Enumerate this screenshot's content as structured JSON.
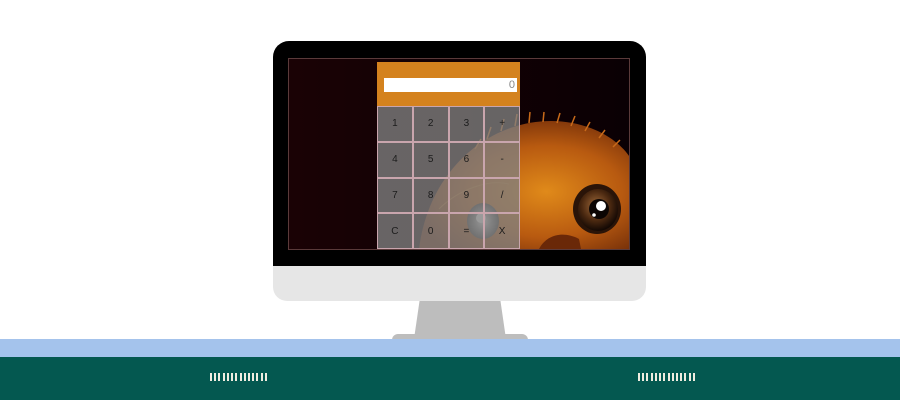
{
  "calculator": {
    "display_value": "0",
    "keys": [
      {
        "label": "1"
      },
      {
        "label": "2"
      },
      {
        "label": "3"
      },
      {
        "label": "+"
      },
      {
        "label": "4"
      },
      {
        "label": "5"
      },
      {
        "label": "6"
      },
      {
        "label": "-"
      },
      {
        "label": "7"
      },
      {
        "label": "8"
      },
      {
        "label": "9"
      },
      {
        "label": "/"
      },
      {
        "label": "C"
      },
      {
        "label": "0"
      },
      {
        "label": "="
      },
      {
        "label": "X"
      }
    ]
  },
  "colors": {
    "display_panel": "#d4821e",
    "key_background": "#808080",
    "desk_top": "#a4c3ec",
    "desk_front": "#045850",
    "monitor_bezel": "#000000",
    "monitor_chin": "#e6e6e6",
    "monitor_stand": "#bdbdbd"
  },
  "icons": {
    "wallpaper": "cartoon-bird-peeking-icon",
    "drawer_handles": "grip-lines-icon"
  }
}
